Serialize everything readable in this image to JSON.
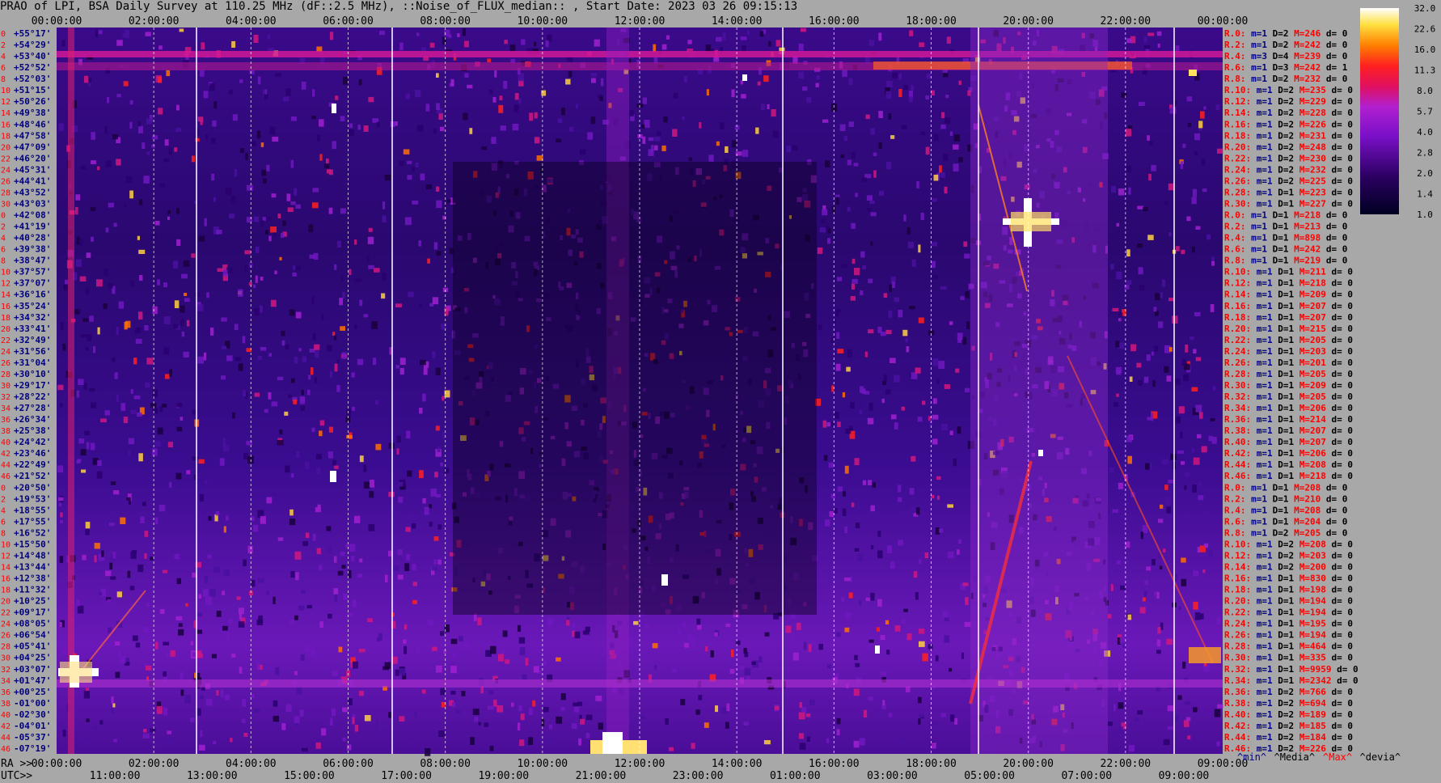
{
  "title": "PRAO of LPI, BSA Daily Survey at 110.25 MHz (dF::2.5 MHz), ::Noise_of_FLUX_median:: , Start Date: 2023 03 26 09:15:13",
  "footer": {
    "ra_prefix": "RA >>",
    "utc_prefix": "UTC>>",
    "stats_labels": [
      "^min^",
      "^Media^",
      "^Max^",
      "^devia^"
    ]
  },
  "colors": {
    "background": "#a8a8a8",
    "ra_labels": "#ff0000",
    "dec_labels": "#000080",
    "stat_R": "#ff0000",
    "stat_m": "#000080",
    "stat_D": "#000000",
    "stat_M": "#ff0000",
    "stat_d": "#000000"
  },
  "chart_data": {
    "type": "heatmap",
    "top_axis_labels": [
      "00:00:00",
      "02:00:00",
      "04:00:00",
      "06:00:00",
      "08:00:00",
      "10:00:00",
      "12:00:00",
      "14:00:00",
      "16:00:00",
      "18:00:00",
      "20:00:00",
      "22:00:00",
      "00:00:00"
    ],
    "ra_axis_labels": [
      "00:00:00",
      "02:00:00",
      "04:00:00",
      "06:00:00",
      "08:00:00",
      "10:00:00",
      "12:00:00",
      "14:00:00",
      "16:00:00",
      "18:00:00",
      "20:00:00",
      "22:00:00",
      "09:00:00"
    ],
    "utc_axis_labels": [
      "11:00:00",
      "13:00:00",
      "15:00:00",
      "17:00:00",
      "19:00:00",
      "21:00:00",
      "23:00:00",
      "01:00:00",
      "03:00:00",
      "05:00:00",
      "07:00:00",
      "09:00:00"
    ],
    "declinations": [
      "+55°17'",
      "+54°29'",
      "+53°40'",
      "+52°52'",
      "+52°03'",
      "+51°15'",
      "+50°26'",
      "+49°38'",
      "+48°46'",
      "+47°58'",
      "+47°09'",
      "+46°20'",
      "+45°31'",
      "+44°41'",
      "+43°52'",
      "+43°03'",
      "+42°08'",
      "+41°19'",
      "+40°28'",
      "+39°38'",
      "+38°47'",
      "+37°57'",
      "+37°07'",
      "+36°16'",
      "+35°24'",
      "+34°32'",
      "+33°41'",
      "+32°49'",
      "+31°56'",
      "+31°04'",
      "+30°10'",
      "+29°17'",
      "+28°22'",
      "+27°28'",
      "+26°34'",
      "+25°38'",
      "+24°42'",
      "+23°46'",
      "+22°49'",
      "+21°52'",
      "+20°50'",
      "+19°53'",
      "+18°55'",
      "+17°55'",
      "+16°52'",
      "+15°50'",
      "+14°48'",
      "+13°44'",
      "+12°38'",
      "+11°32'",
      "+10°25'",
      "+09°17'",
      "+08°05'",
      "+06°54'",
      "+05°41'",
      "+04°25'",
      "+03°07'",
      "+01°47'",
      "+00°25'",
      "-01°00'",
      "-02°30'",
      "-04°01'",
      "-05°37'",
      "-07°19'"
    ],
    "row_numbers": [
      "0",
      "2",
      "4",
      "6",
      "8",
      "10",
      "12",
      "14",
      "16",
      "18",
      "20",
      "22",
      "24",
      "26",
      "28",
      "30",
      "0",
      "2",
      "4",
      "6",
      "8",
      "10",
      "12",
      "14",
      "16",
      "18",
      "20",
      "22",
      "24",
      "26",
      "28",
      "30",
      "32",
      "34",
      "36",
      "38",
      "40",
      "42",
      "44",
      "46",
      "0",
      "2",
      "4",
      "6",
      "8",
      "10",
      "12",
      "14",
      "16",
      "18",
      "20",
      "22",
      "24",
      "26",
      "28",
      "30",
      "32",
      "34",
      "36",
      "38",
      "40",
      "42",
      "44",
      "46"
    ],
    "colorbar": {
      "ticks": [
        "32.0",
        "22.6",
        "16.0",
        "11.3",
        "8.0",
        "5.7",
        "4.0",
        "2.8",
        "2.0",
        "1.4",
        "1.0"
      ],
      "min": 1.0,
      "max": 32.0,
      "scale": "log2"
    },
    "row_stats": [
      {
        "R": "R.0:",
        "m": "m=1",
        "D": "D=2",
        "M": "M=246",
        "d": "d= 0"
      },
      {
        "R": "R.2:",
        "m": "m=1",
        "D": "D=2",
        "M": "M=242",
        "d": "d= 0"
      },
      {
        "R": "R.4:",
        "m": "m=3",
        "D": "D=4",
        "M": "M=239",
        "d": "d= 0"
      },
      {
        "R": "R.6:",
        "m": "m=1",
        "D": "D=3",
        "M": "M=242",
        "d": "d= 1"
      },
      {
        "R": "R.8:",
        "m": "m=1",
        "D": "D=2",
        "M": "M=232",
        "d": "d= 0"
      },
      {
        "R": "R.10:",
        "m": "m=1",
        "D": "D=2",
        "M": "M=235",
        "d": "d= 0"
      },
      {
        "R": "R.12:",
        "m": "m=1",
        "D": "D=2",
        "M": "M=229",
        "d": "d= 0"
      },
      {
        "R": "R.14:",
        "m": "m=1",
        "D": "D=2",
        "M": "M=228",
        "d": "d= 0"
      },
      {
        "R": "R.16:",
        "m": "m=1",
        "D": "D=2",
        "M": "M=226",
        "d": "d= 0"
      },
      {
        "R": "R.18:",
        "m": "m=1",
        "D": "D=2",
        "M": "M=231",
        "d": "d= 0"
      },
      {
        "R": "R.20:",
        "m": "m=1",
        "D": "D=2",
        "M": "M=248",
        "d": "d= 0"
      },
      {
        "R": "R.22:",
        "m": "m=1",
        "D": "D=2",
        "M": "M=230",
        "d": "d= 0"
      },
      {
        "R": "R.24:",
        "m": "m=1",
        "D": "D=2",
        "M": "M=232",
        "d": "d= 0"
      },
      {
        "R": "R.26:",
        "m": "m=1",
        "D": "D=2",
        "M": "M=225",
        "d": "d= 0"
      },
      {
        "R": "R.28:",
        "m": "m=1",
        "D": "D=1",
        "M": "M=223",
        "d": "d= 0"
      },
      {
        "R": "R.30:",
        "m": "m=1",
        "D": "D=1",
        "M": "M=227",
        "d": "d= 0"
      },
      {
        "R": "R.0:",
        "m": "m=1",
        "D": "D=1",
        "M": "M=218",
        "d": "d= 0"
      },
      {
        "R": "R.2:",
        "m": "m=1",
        "D": "D=1",
        "M": "M=213",
        "d": "d= 0"
      },
      {
        "R": "R.4:",
        "m": "m=1",
        "D": "D=1",
        "M": "M=898",
        "d": "d= 0"
      },
      {
        "R": "R.6:",
        "m": "m=1",
        "D": "D=1",
        "M": "M=242",
        "d": "d= 0"
      },
      {
        "R": "R.8:",
        "m": "m=1",
        "D": "D=1",
        "M": "M=219",
        "d": "d= 0"
      },
      {
        "R": "R.10:",
        "m": "m=1",
        "D": "D=1",
        "M": "M=211",
        "d": "d= 0"
      },
      {
        "R": "R.12:",
        "m": "m=1",
        "D": "D=1",
        "M": "M=218",
        "d": "d= 0"
      },
      {
        "R": "R.14:",
        "m": "m=1",
        "D": "D=1",
        "M": "M=209",
        "d": "d= 0"
      },
      {
        "R": "R.16:",
        "m": "m=1",
        "D": "D=1",
        "M": "M=207",
        "d": "d= 0"
      },
      {
        "R": "R.18:",
        "m": "m=1",
        "D": "D=1",
        "M": "M=207",
        "d": "d= 0"
      },
      {
        "R": "R.20:",
        "m": "m=1",
        "D": "D=1",
        "M": "M=215",
        "d": "d= 0"
      },
      {
        "R": "R.22:",
        "m": "m=1",
        "D": "D=1",
        "M": "M=205",
        "d": "d= 0"
      },
      {
        "R": "R.24:",
        "m": "m=1",
        "D": "D=1",
        "M": "M=203",
        "d": "d= 0"
      },
      {
        "R": "R.26:",
        "m": "m=1",
        "D": "D=1",
        "M": "M=201",
        "d": "d= 0"
      },
      {
        "R": "R.28:",
        "m": "m=1",
        "D": "D=1",
        "M": "M=205",
        "d": "d= 0"
      },
      {
        "R": "R.30:",
        "m": "m=1",
        "D": "D=1",
        "M": "M=209",
        "d": "d= 0"
      },
      {
        "R": "R.32:",
        "m": "m=1",
        "D": "D=1",
        "M": "M=205",
        "d": "d= 0"
      },
      {
        "R": "R.34:",
        "m": "m=1",
        "D": "D=1",
        "M": "M=206",
        "d": "d= 0"
      },
      {
        "R": "R.36:",
        "m": "m=1",
        "D": "D=1",
        "M": "M=214",
        "d": "d= 0"
      },
      {
        "R": "R.38:",
        "m": "m=1",
        "D": "D=1",
        "M": "M=207",
        "d": "d= 0"
      },
      {
        "R": "R.40:",
        "m": "m=1",
        "D": "D=1",
        "M": "M=207",
        "d": "d= 0"
      },
      {
        "R": "R.42:",
        "m": "m=1",
        "D": "D=1",
        "M": "M=206",
        "d": "d= 0"
      },
      {
        "R": "R.44:",
        "m": "m=1",
        "D": "D=1",
        "M": "M=208",
        "d": "d= 0"
      },
      {
        "R": "R.46:",
        "m": "m=1",
        "D": "D=1",
        "M": "M=218",
        "d": "d= 0"
      },
      {
        "R": "R.0:",
        "m": "m=1",
        "D": "D=1",
        "M": "M=208",
        "d": "d= 0"
      },
      {
        "R": "R.2:",
        "m": "m=1",
        "D": "D=1",
        "M": "M=210",
        "d": "d= 0"
      },
      {
        "R": "R.4:",
        "m": "m=1",
        "D": "D=1",
        "M": "M=208",
        "d": "d= 0"
      },
      {
        "R": "R.6:",
        "m": "m=1",
        "D": "D=1",
        "M": "M=204",
        "d": "d= 0"
      },
      {
        "R": "R.8:",
        "m": "m=1",
        "D": "D=2",
        "M": "M=205",
        "d": "d= 0"
      },
      {
        "R": "R.10:",
        "m": "m=1",
        "D": "D=2",
        "M": "M=208",
        "d": "d= 0"
      },
      {
        "R": "R.12:",
        "m": "m=1",
        "D": "D=2",
        "M": "M=203",
        "d": "d= 0"
      },
      {
        "R": "R.14:",
        "m": "m=1",
        "D": "D=2",
        "M": "M=200",
        "d": "d= 0"
      },
      {
        "R": "R.16:",
        "m": "m=1",
        "D": "D=1",
        "M": "M=830",
        "d": "d= 0"
      },
      {
        "R": "R.18:",
        "m": "m=1",
        "D": "D=1",
        "M": "M=198",
        "d": "d= 0"
      },
      {
        "R": "R.20:",
        "m": "m=1",
        "D": "D=1",
        "M": "M=194",
        "d": "d= 0"
      },
      {
        "R": "R.22:",
        "m": "m=1",
        "D": "D=1",
        "M": "M=194",
        "d": "d= 0"
      },
      {
        "R": "R.24:",
        "m": "m=1",
        "D": "D=1",
        "M": "M=195",
        "d": "d= 0"
      },
      {
        "R": "R.26:",
        "m": "m=1",
        "D": "D=1",
        "M": "M=194",
        "d": "d= 0"
      },
      {
        "R": "R.28:",
        "m": "m=1",
        "D": "D=1",
        "M": "M=464",
        "d": "d= 0"
      },
      {
        "R": "R.30:",
        "m": "m=1",
        "D": "D=1",
        "M": "M=335",
        "d": "d= 0"
      },
      {
        "R": "R.32:",
        "m": "m=1",
        "D": "D=1",
        "M": "M=9959",
        "d": "d= 0"
      },
      {
        "R": "R.34:",
        "m": "m=1",
        "D": "D=1",
        "M": "M=2342",
        "d": "d= 0"
      },
      {
        "R": "R.36:",
        "m": "m=1",
        "D": "D=2",
        "M": "M=766",
        "d": "d= 0"
      },
      {
        "R": "R.38:",
        "m": "m=1",
        "D": "D=2",
        "M": "M=694",
        "d": "d= 0"
      },
      {
        "R": "R.40:",
        "m": "m=1",
        "D": "D=2",
        "M": "M=189",
        "d": "d= 0"
      },
      {
        "R": "R.42:",
        "m": "m=1",
        "D": "D=2",
        "M": "M=185",
        "d": "d= 0"
      },
      {
        "R": "R.44:",
        "m": "m=1",
        "D": "D=2",
        "M": "M=184",
        "d": "d= 0"
      },
      {
        "R": "R.46:",
        "m": "m=1",
        "D": "D=2",
        "M": "M=226",
        "d": "d= 0"
      }
    ]
  }
}
